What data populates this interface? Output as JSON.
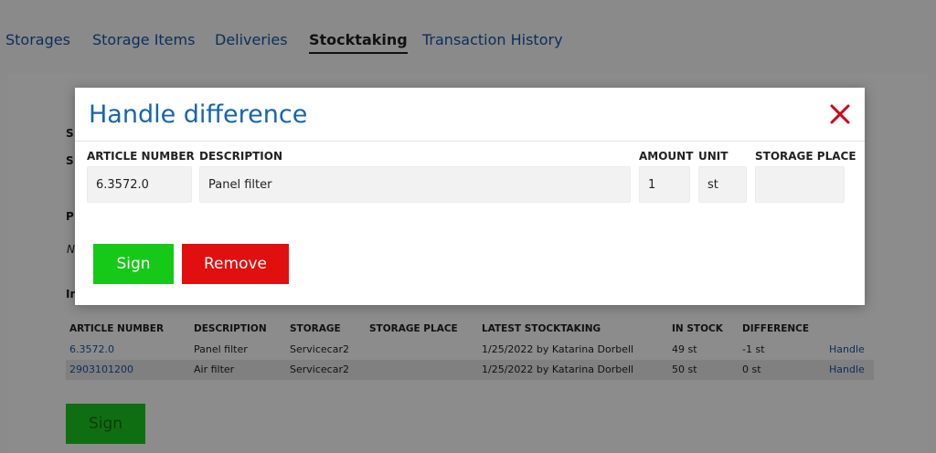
{
  "nav": {
    "items": [
      {
        "label": "Storages"
      },
      {
        "label": "Storage Items"
      },
      {
        "label": "Deliveries"
      },
      {
        "label": "Stocktaking",
        "active": true
      },
      {
        "label": "Transaction History"
      }
    ]
  },
  "background": {
    "stubs": [
      "S",
      "S",
      "P",
      "N",
      "In"
    ],
    "table": {
      "headers": [
        "ARTICLE NUMBER",
        "DESCRIPTION",
        "STORAGE",
        "STORAGE PLACE",
        "LATEST STOCKTAKING",
        "IN STOCK",
        "DIFFERENCE"
      ],
      "rows": [
        {
          "article_number": "6.3572.0",
          "description": "Panel filter",
          "storage": "Servicecar2",
          "storage_place": "",
          "latest_stocktaking": "1/25/2022 by Katarina Dorbell",
          "in_stock": "49 st",
          "difference": "-1 st",
          "action": "Handle"
        },
        {
          "article_number": "2903101200",
          "description": "Air filter",
          "storage": "Servicecar2",
          "storage_place": "",
          "latest_stocktaking": "1/25/2022 by Katarina Dorbell",
          "in_stock": "50 st",
          "difference": "0 st",
          "action": "Handle"
        }
      ]
    },
    "sign_label": "Sign"
  },
  "modal": {
    "title": "Handle difference",
    "columns": {
      "article_number": "ARTICLE NUMBER",
      "description": "DESCRIPTION",
      "amount": "AMOUNT",
      "unit": "UNIT",
      "storage_place": "STORAGE PLACE"
    },
    "values": {
      "article_number": "6.3572.0",
      "description": "Panel filter",
      "amount": "1",
      "unit": "st",
      "storage_place": ""
    },
    "sign_label": "Sign",
    "remove_label": "Remove"
  },
  "colors": {
    "title_blue": "#1565b2",
    "sign_green": "#16c918",
    "remove_red": "#e20f0f",
    "close_red": "#d0021b"
  }
}
